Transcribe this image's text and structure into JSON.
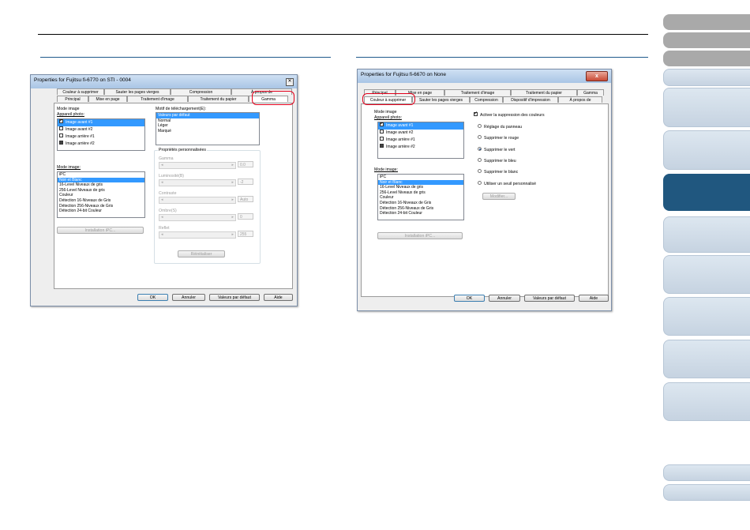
{
  "nav": {
    "tabs": [
      {
        "style": "gray"
      },
      {
        "style": "gray"
      },
      {
        "style": "gray"
      },
      {
        "style": "light"
      },
      {
        "style": "light"
      },
      {
        "style": "light"
      },
      {
        "style": "dark"
      },
      {
        "style": "light"
      },
      {
        "style": "light"
      },
      {
        "style": "light"
      },
      {
        "style": "light"
      },
      {
        "style": "light"
      },
      {
        "style": "light"
      },
      {
        "style": "light"
      }
    ]
  },
  "dialog1": {
    "title": "Properties for Fujitsu fi-6770 on STI - 0004",
    "tabs_back": [
      "Couleur à supprimer",
      "Sauter les pages vierges",
      "Compression",
      "À propos de"
    ],
    "tabs_front": [
      "Principal",
      "Mise en page",
      "Traitement d'image",
      "Traitement du papier",
      "Gamma"
    ],
    "mode_image_group": "Mode image",
    "appareil_label": "Appareil photo:",
    "camera_items": [
      "Image avant #1",
      "Image avant #2",
      "Image arrière #1",
      "Image arrière #2"
    ],
    "mode_label": "Mode image:",
    "mode_items": [
      "iPC",
      "Noir et Blanc",
      "16-Level Niveaux de gris",
      "256-Level Niveaux de gris",
      "Couleur",
      "Détection 16-Niveaux de Gris",
      "Détection 256-Niveaux de Gris",
      "Détection 24-bit Couleur"
    ],
    "install_button": "Installation iPC...",
    "motif_label": "Motif de téléchargement(E):",
    "motif_items": [
      "Valeurs par défaut",
      "Normal",
      "Léger",
      "Marqué"
    ],
    "custom_group": "Propriétés personnalisées",
    "sliders": [
      {
        "label": "Gamma",
        "value": "0.0"
      },
      {
        "label": "Luminosité(B)",
        "value": "-2"
      },
      {
        "label": "Contraste",
        "value": "Auto"
      },
      {
        "label": "Ombre(S)",
        "value": "0"
      },
      {
        "label": "Reflet",
        "value": "255"
      }
    ],
    "reset_button": "Réinitialiser",
    "buttons": [
      "OK",
      "Annuler",
      "Valeurs par défaut",
      "Aide"
    ]
  },
  "dialog2": {
    "title": "Properties for Fujitsu fi-6670 on None",
    "close_glyph": "x",
    "tabs_back": [
      "Principal",
      "Mise en page",
      "Traitement d'image",
      "Traitement du papier",
      "Gamma"
    ],
    "tabs_front": [
      "Couleur à supprimer",
      "Sauter les pages vierges",
      "Compression",
      "Dispositif d'impression",
      "À propos de"
    ],
    "mode_image_group": "Mode image",
    "appareil_label": "Appareil photo:",
    "camera_items": [
      "Image avant #1",
      "Image avant #2",
      "Image arrière #1",
      "Image arrière #2"
    ],
    "mode_label": "Mode image:",
    "mode_items": [
      "iPC",
      "Noir et Blanc",
      "16-Level Niveaux de gris",
      "256-Level Niveaux de gris",
      "Couleur",
      "Détection 16-Niveaux de Gris",
      "Détection 256-Niveaux de Gris",
      "Détection 24-bit Couleur"
    ],
    "install_button": "Installation iPC...",
    "activate_label": "Activer la suppression des couleurs",
    "radios": [
      "Réglage du panneau",
      "Supprimer le rouge",
      "Supprimer le vert",
      "Supprimer le bleu",
      "Supprimer le blanc",
      "Utiliser un seuil personnalisé"
    ],
    "selected_radio": 2,
    "modify_button": "Modifier...",
    "buttons": [
      "OK",
      "Annuler",
      "Valeurs par défaut",
      "Aide"
    ]
  },
  "colors": {
    "accent": "#20577f",
    "highlight": "#e3001b",
    "selection": "#3399ff"
  }
}
